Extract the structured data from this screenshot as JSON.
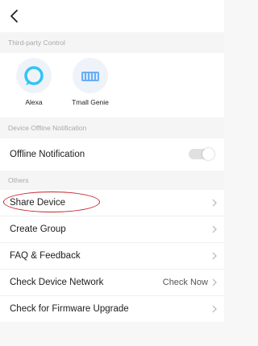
{
  "topbar": {
    "back_icon": "chevron-left-icon"
  },
  "sections": {
    "third_party": "Third-party Control",
    "offline": "Device Offline Notification",
    "others": "Others"
  },
  "integrations": [
    {
      "label": "Alexa",
      "icon": "alexa-icon",
      "color": "#31c4f3"
    },
    {
      "label": "Tmall Genie",
      "icon": "tmall-genie-icon",
      "color": "#5aa4ff"
    }
  ],
  "offline_notification": {
    "label": "Offline Notification",
    "enabled": false
  },
  "others_rows": {
    "share_device": "Share Device",
    "create_group": "Create Group",
    "faq_feedback": "FAQ & Feedback",
    "check_network": "Check Device Network",
    "check_network_action": "Check Now",
    "firmware": "Check for Firmware Upgrade"
  },
  "colors": {
    "highlight": "#c4242b",
    "toggle_off": "#e0e0e0"
  }
}
